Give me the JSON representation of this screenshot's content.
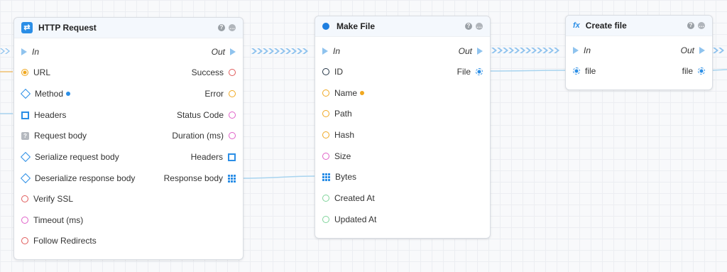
{
  "nodes": {
    "http_request": {
      "title": "HTTP Request",
      "in_label": "In",
      "out_label": "Out",
      "inputs": [
        "URL",
        "Method",
        "Headers",
        "Request body",
        "Serialize request body",
        "Deserialize response body",
        "Verify SSL",
        "Timeout (ms)",
        "Follow Redirects"
      ],
      "outputs": [
        "Success",
        "Error",
        "Status Code",
        "Duration (ms)",
        "Headers",
        "Response body"
      ]
    },
    "make_file": {
      "title": "Make File",
      "in_label": "In",
      "out_label": "Out",
      "inputs": [
        "ID",
        "Name",
        "Path",
        "Hash",
        "Size",
        "Bytes",
        "Created At",
        "Updated At"
      ],
      "outputs": [
        "File"
      ]
    },
    "create_file": {
      "title": "Create file",
      "icon_text": "fx",
      "in_label": "In",
      "out_label": "Out",
      "inputs": [
        "file"
      ],
      "outputs": [
        "file"
      ]
    }
  },
  "icons": {
    "help": "question-icon",
    "comment": "comment-icon"
  },
  "colors": {
    "exec_wire": "#8fc3ee",
    "data_wire": "#a8d4ef",
    "accent": "#2b8ee6",
    "pin_yellow": "#f0a820",
    "pin_red": "#e05a5a",
    "pin_pink": "#e060c8",
    "pin_green": "#7fd49a",
    "pin_navy": "#223344"
  }
}
